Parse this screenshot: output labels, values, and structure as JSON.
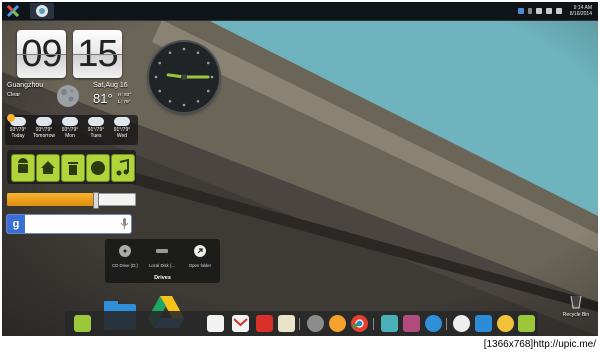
{
  "taskbar": {
    "tray_time": "9:14 AM",
    "tray_date": "8/16/2014"
  },
  "clock_widget": {
    "hours": "09",
    "minutes": "15",
    "city": "Guangzhou",
    "condition": "Clear",
    "date": "Sat,Aug 16",
    "temp": "81°",
    "high": "H: 93°",
    "low": "L: 79°"
  },
  "forecast": [
    {
      "temps": "93°/79°",
      "day": "Today",
      "icon": "partly-sunny-icon"
    },
    {
      "temps": "93°/79°",
      "day": "Tomorrow",
      "icon": "cloudy-icon"
    },
    {
      "temps": "93°/79°",
      "day": "Mon",
      "icon": "cloudy-icon"
    },
    {
      "temps": "91°/79°",
      "day": "Tues",
      "icon": "cloudy-icon"
    },
    {
      "temps": "91°/79°",
      "day": "Wed",
      "icon": "cloudy-icon"
    }
  ],
  "analog_clock": {
    "hour": 9,
    "minute": 15
  },
  "app_bar": [
    "android-icon",
    "home-icon",
    "trash-icon",
    "globe-icon",
    "music-icon"
  ],
  "volume": {
    "level": 0.68
  },
  "drives_popup": {
    "title": "Drives",
    "items": [
      {
        "label": "CD Drive (D:)",
        "icon": "cd-drive-icon"
      },
      {
        "label": "Local Disk (...",
        "icon": "local-disk-icon"
      },
      {
        "label": "Open folder",
        "icon": "open-folder-icon"
      }
    ]
  },
  "desktop": {
    "recycle_bin_label": "Recycle Bin"
  },
  "caption": "[1366x768]http://upic.me/",
  "colors": {
    "accent_green": "#9dc73a",
    "orange": "#f0a020",
    "google_blue": "#3b6fd6",
    "taskbar": "#0f1418"
  }
}
